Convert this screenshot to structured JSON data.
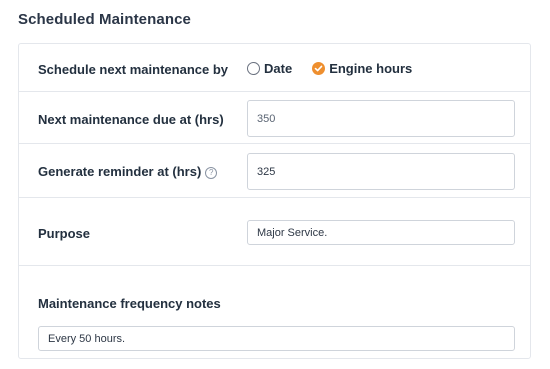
{
  "section": {
    "title": "Scheduled Maintenance"
  },
  "schedule": {
    "label": "Schedule next maintenance by",
    "options": [
      {
        "label": "Date",
        "selected": false
      },
      {
        "label": "Engine hours",
        "selected": true
      }
    ],
    "accent_color": "#ee8f2f"
  },
  "next_due": {
    "label": "Next maintenance due at (hrs)",
    "value": "350"
  },
  "reminder": {
    "label": "Generate reminder at (hrs)",
    "help_icon": "help-circle-icon",
    "value": "325"
  },
  "purpose": {
    "label": "Purpose",
    "value": "Major Service."
  },
  "notes": {
    "label": "Maintenance frequency notes",
    "value": "Every 50 hours."
  }
}
